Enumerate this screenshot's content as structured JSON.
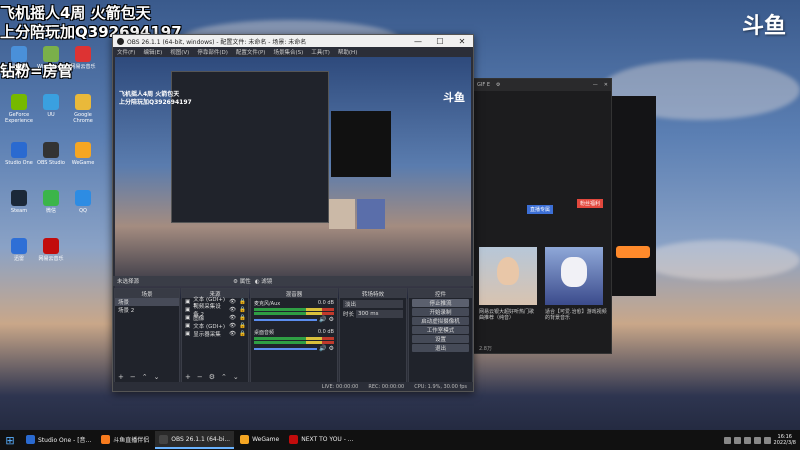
{
  "overlay": {
    "line1": "飞机摇人4周 火箭包天",
    "line2": "上分陪玩加Q392694197",
    "line3": "钻粉=房管",
    "logo": "斗鱼"
  },
  "desktop_icons": [
    {
      "label": "此电脑",
      "color": "#4a90d9"
    },
    {
      "label": "Wire Mac...",
      "color": "#7ab04a"
    },
    {
      "label": "网易云音乐",
      "color": "#d33"
    },
    {
      "label": "GeForce Experience",
      "color": "#76b900"
    },
    {
      "label": "UU",
      "color": "#3aa0e0"
    },
    {
      "label": "Google Chrome",
      "color": "#e9b93a"
    },
    {
      "label": "Studio One",
      "color": "#2a6ad0"
    },
    {
      "label": "OBS Studio",
      "color": "#333"
    },
    {
      "label": "WeGame",
      "color": "#f5a623"
    },
    {
      "label": "Steam",
      "color": "#1b2838"
    },
    {
      "label": "微信",
      "color": "#3bb54a"
    },
    {
      "label": "QQ",
      "color": "#2d8ce3"
    },
    {
      "label": "迅雷",
      "color": "#2e6fd6"
    },
    {
      "label": "网易云音乐",
      "color": "#c20c0c"
    }
  ],
  "obs": {
    "title": "OBS 26.1.1 (64-bit, windows) - 配置文件: 未命名 - 场景: 未命名",
    "menu": [
      "文件(F)",
      "编辑(E)",
      "视图(V)",
      "停靠部件(D)",
      "配置文件(P)",
      "场景集合(S)",
      "工具(T)",
      "帮助(H)"
    ],
    "toolbar_label": "未选择源",
    "toolbar_buttons": [
      "属性",
      "滤镜"
    ],
    "docks": {
      "scenes": {
        "title": "场景",
        "items": [
          "场景",
          "场景 2"
        ]
      },
      "sources": {
        "title": "来源",
        "items": [
          "文本 (GDI+) 5",
          "视频采集设备 2",
          "图像",
          "文本 (GDI+)",
          "显示器采集"
        ]
      },
      "mixer": {
        "title": "混音器",
        "channels": [
          {
            "name": "麦克风/Aux",
            "db": "0.0 dB"
          },
          {
            "name": "桌面音频",
            "db": "0.0 dB"
          }
        ]
      },
      "transitions": {
        "title": "转场特效",
        "type": "淡出",
        "duration_label": "时长",
        "duration": "300 ms"
      },
      "controls": {
        "title": "控件",
        "buttons": [
          "停止推流",
          "开始录制",
          "启动虚拟摄像机",
          "工作室模式",
          "设置",
          "退出"
        ]
      }
    },
    "status": [
      "LIVE: 00:00:00",
      "REC: 00:00:00",
      "CPU: 1.9%, 30.00 fps"
    ]
  },
  "live": {
    "header_label": "GIF E",
    "tag1": "直播专属",
    "tag2": "粉丝福利",
    "thumb_captions": [
      "网易云银大超好听热门歌曲推荐（纯音）",
      "适合【可爱.治愈】游戏视频的背景音乐"
    ],
    "count": "2.8万"
  },
  "taskbar": {
    "items": [
      {
        "label": "Studio One - [音...",
        "color": "#2a6ad0"
      },
      {
        "label": "斗鱼直播伴侣",
        "color": "#f77b1e"
      },
      {
        "label": "OBS 26.1.1 (64-bi...",
        "color": "#444"
      },
      {
        "label": "WeGame",
        "color": "#f5a623"
      },
      {
        "label": "NEXT TO YOU - ...",
        "color": "#c20c0c"
      }
    ],
    "time": "16:16",
    "date": "2022/3/8"
  }
}
